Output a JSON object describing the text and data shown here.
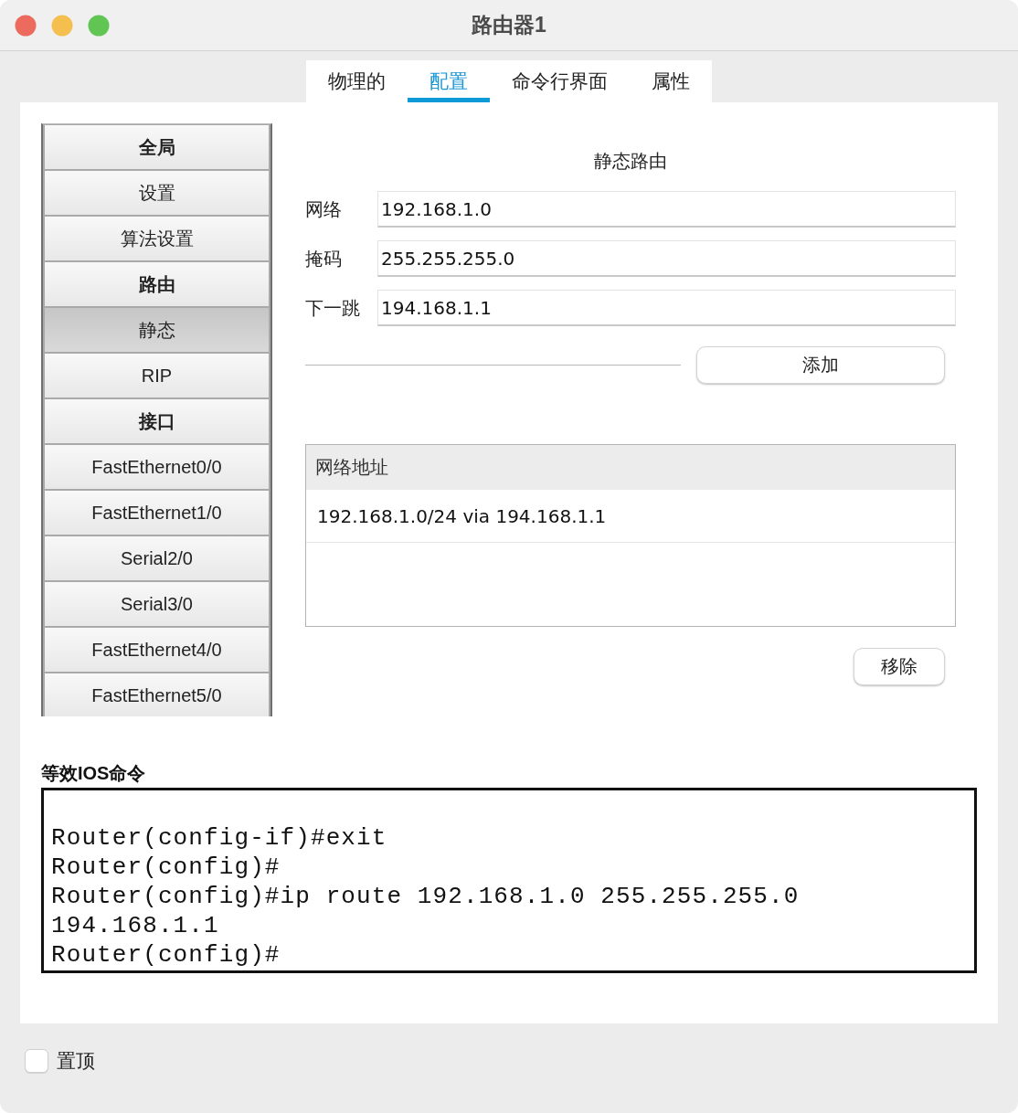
{
  "window": {
    "title": "路由器1"
  },
  "tabs": [
    {
      "label": "物理的",
      "selected": false
    },
    {
      "label": "配置",
      "selected": true
    },
    {
      "label": "命令行界面",
      "selected": false
    },
    {
      "label": "属性",
      "selected": false
    }
  ],
  "sidebar": {
    "items": [
      {
        "label": "全局",
        "kind": "header",
        "selected": false
      },
      {
        "label": "设置",
        "kind": "item",
        "selected": false
      },
      {
        "label": "算法设置",
        "kind": "item",
        "selected": false
      },
      {
        "label": "路由",
        "kind": "header",
        "selected": false
      },
      {
        "label": "静态",
        "kind": "item",
        "selected": true
      },
      {
        "label": "RIP",
        "kind": "item",
        "selected": false
      },
      {
        "label": "接口",
        "kind": "header",
        "selected": false
      },
      {
        "label": "FastEthernet0/0",
        "kind": "item",
        "selected": false
      },
      {
        "label": "FastEthernet1/0",
        "kind": "item",
        "selected": false
      },
      {
        "label": "Serial2/0",
        "kind": "item",
        "selected": false
      },
      {
        "label": "Serial3/0",
        "kind": "item",
        "selected": false
      },
      {
        "label": "FastEthernet4/0",
        "kind": "item",
        "selected": false
      },
      {
        "label": "FastEthernet5/0",
        "kind": "item",
        "selected": false
      }
    ]
  },
  "static_route": {
    "title": "静态路由",
    "fields": [
      {
        "label": "网络",
        "value": "192.168.1.0"
      },
      {
        "label": "掩码",
        "value": "255.255.255.0"
      },
      {
        "label": "下一跳",
        "value": "194.168.1.1"
      }
    ],
    "add_button": "添加",
    "table": {
      "column": "网络地址",
      "rows": [
        {
          "text": "192.168.1.0/24 via 194.168.1.1",
          "selected": false
        }
      ]
    },
    "remove_button": "移除"
  },
  "ios_commands": {
    "label": "等效IOS命令",
    "lines": [
      "Router(config-if)#exit",
      "Router(config)#",
      "Router(config)#ip route 192.168.1.0 255.255.255.0",
      "194.168.1.1",
      "Router(config)#"
    ]
  },
  "footer": {
    "stay_on_top": {
      "label": "置顶",
      "checked": false
    }
  }
}
